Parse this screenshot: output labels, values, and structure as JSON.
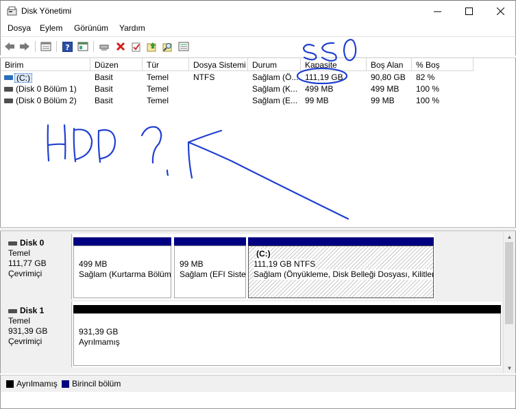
{
  "window": {
    "title": "Disk Yönetimi"
  },
  "menu": [
    "Dosya",
    "Eylem",
    "Görünüm",
    "Yardım"
  ],
  "toolbar_icons": [
    "back-icon",
    "forward-icon",
    "properties-view-icon",
    "help-icon",
    "properties-icon",
    "connect-icon",
    "delete-icon",
    "checkmark-icon",
    "upload-icon",
    "search-icon",
    "settings-icon"
  ],
  "table": {
    "columns": [
      "Birim",
      "Düzen",
      "Tür",
      "Dosya Sistemi",
      "Durum",
      "Kapasite",
      "Boş Alan",
      "% Boş"
    ],
    "rows": [
      {
        "birim": "(C:)",
        "duzen": "Basit",
        "tur": "Temel",
        "dosya": "NTFS",
        "durum": "Sağlam (Ö...",
        "kapasite": "111,19 GB",
        "bos": "90,80 GB",
        "yuzde": "82 %"
      },
      {
        "birim": "(Disk 0 Bölüm 1)",
        "duzen": "Basit",
        "tur": "Temel",
        "dosya": "",
        "durum": "Sağlam (K...",
        "kapasite": "499 MB",
        "bos": "499 MB",
        "yuzde": "100 %"
      },
      {
        "birim": "(Disk 0 Bölüm 2)",
        "duzen": "Basit",
        "tur": "Temel",
        "dosya": "",
        "durum": "Sağlam (E...",
        "kapasite": "99 MB",
        "bos": "99 MB",
        "yuzde": "100 %"
      }
    ]
  },
  "disks": [
    {
      "name": "Disk 0",
      "type": "Temel",
      "size": "111,77 GB",
      "status": "Çevrimiçi",
      "partitions": [
        {
          "line1": "",
          "line2": "499 MB",
          "line3": "Sağlam (Kurtarma Bölüm"
        },
        {
          "line1": "",
          "line2": "99 MB",
          "line3": "Sağlam (EFI Sister"
        },
        {
          "line1": "(C:)",
          "line2": "111,19 GB NTFS",
          "line3": "Sağlam (Önyükleme, Disk Belleği Dosyası, Kilitlen"
        }
      ]
    },
    {
      "name": "Disk 1",
      "type": "Temel",
      "size": "931,39 GB",
      "status": "Çevrimiçi",
      "partitions": [
        {
          "line1": "",
          "line2": "931,39 GB",
          "line3": "Ayrılmamış"
        }
      ]
    }
  ],
  "legend": [
    {
      "label": "Ayrılmamış",
      "color": "#000000"
    },
    {
      "label": "Birincil bölüm",
      "color": "#000080"
    }
  ],
  "colors": {
    "primary_partition": "#000080",
    "unallocated": "#000000",
    "volume_icon": "#2a6ebb",
    "annotation_ink": "#1f3fd1"
  }
}
